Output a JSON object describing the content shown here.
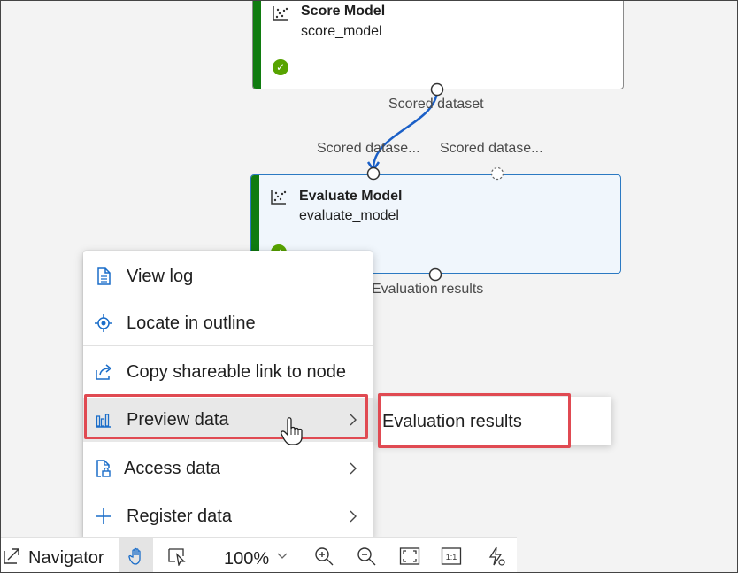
{
  "nodes": {
    "score": {
      "title": "Score Model",
      "subtitle": "score_model",
      "output_port_label": "Scored dataset"
    },
    "evaluate": {
      "title": "Evaluate Model",
      "subtitle": "evaluate_model",
      "input_port_labels": [
        "Scored datase...",
        "Scored datase..."
      ],
      "output_port_label": "Evaluation results"
    }
  },
  "context_menu": {
    "items": [
      {
        "label": "View log",
        "icon": "document-icon"
      },
      {
        "label": "Locate in outline",
        "icon": "locate-icon"
      },
      {
        "label": "Copy shareable link to node",
        "icon": "share-icon"
      },
      {
        "label": "Preview data",
        "icon": "bar-chart-icon",
        "has_submenu": true,
        "highlighted": true
      },
      {
        "label": "Access data",
        "icon": "file-lock-icon",
        "has_submenu": true
      },
      {
        "label": "Register data",
        "icon": "plus-icon",
        "has_submenu": true
      }
    ]
  },
  "submenu": {
    "items": [
      "Evaluation results"
    ]
  },
  "toolbar": {
    "navigator_label": "Navigator",
    "zoom_level": "100%",
    "icons": [
      "navigator-icon",
      "pan-hand-icon",
      "select-icon",
      "zoom-in-icon",
      "zoom-out-icon",
      "fit-screen-icon",
      "actual-size-icon",
      "auto-layout-icon"
    ]
  },
  "colors": {
    "completed_bar": "#107c10",
    "status_success": "#57a300",
    "selection_border": "#2b79c2",
    "callout_red": "#e04a52",
    "wire": "#1a5fc7"
  }
}
